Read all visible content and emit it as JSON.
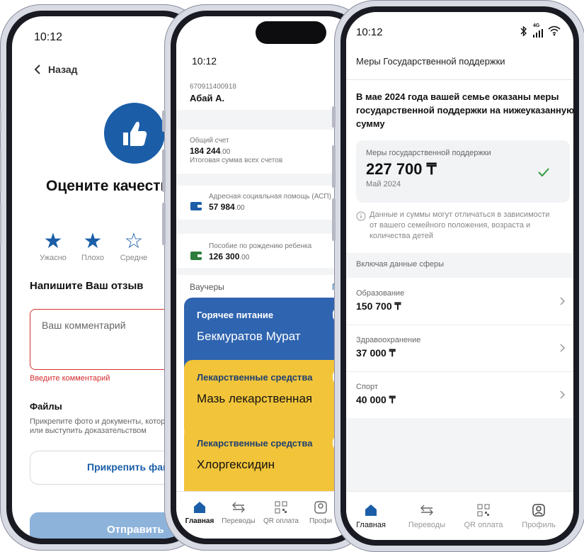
{
  "phone1": {
    "time": "10:12",
    "back_label": "Назад",
    "title": "Оцените качество",
    "ratings": [
      "Ужасно",
      "Плохо",
      "Средне"
    ],
    "ratings_selected": 2,
    "review_heading": "Напишите Ваш отзыв",
    "comment_placeholder": "Ваш комментарий",
    "comment_error": "Введите комментарий",
    "files_heading": "Файлы",
    "files_hint_line1": "Прикрепите фото и документы, котор",
    "files_hint_line2": "или выступить доказательством",
    "attach_button": "Прикрепить фай",
    "submit_button": "Отправить"
  },
  "phone2": {
    "time": "10:12",
    "account_number": "670911400918",
    "user_name": "Абай А.",
    "total": {
      "label": "Общий счет",
      "amount_main": "184 244",
      "amount_cents": ".00",
      "note": "Итоговая сумма всех счетов"
    },
    "accounts": [
      {
        "label": "Адресная социальная помощь (АСП)",
        "amount_main": "57 984",
        "amount_cents": ".00",
        "color": "#1b5ea7"
      },
      {
        "label": "Пособие по рождению ребенка",
        "amount_main": "126 300",
        "amount_cents": ".00",
        "color": "#2e7d3c"
      }
    ],
    "vouchers_heading": "Ваучеры",
    "vouchers_link": "П",
    "vouchers": [
      {
        "category": "Горячее питание",
        "name": "Бекмуратов Мурат",
        "color": "#2f64b0"
      },
      {
        "category": "Лекарственные средства",
        "name": "Мазь лекарственная",
        "color": "#f2c43a"
      },
      {
        "category": "Лекарственные средства",
        "name": "Хлоргексидин",
        "color": "#f2c43a"
      }
    ],
    "nav": [
      "Главная",
      "Переводы",
      "QR оплата",
      "Профи"
    ]
  },
  "phone3": {
    "time": "10:12",
    "network": "4G",
    "header_title": "Меры Государственной поддержки",
    "intro": [
      "В мае 2024 года вашей семье оказаны меры",
      "государственной поддержки на нижеуказанную",
      "сумму"
    ],
    "summary": {
      "label": "Меры государственной поддержки",
      "amount": "227 700 ₸",
      "period": "Май 2024"
    },
    "note": [
      "Данные и суммы могут отличаться в зависимости",
      "от вашего семейного положения, возраста и",
      "количества детей"
    ],
    "section_label": "Включая данные сферы",
    "spheres": [
      {
        "name": "Образование",
        "amount": "150 700 ₸"
      },
      {
        "name": "Здравоохранение",
        "amount": "37 000 ₸"
      },
      {
        "name": "Спорт",
        "amount": "40 000 ₸"
      }
    ],
    "nav": [
      "Главная",
      "Переводы",
      "QR оплата",
      "Профиль"
    ],
    "nav_active": 0
  },
  "colors": {
    "primary": "#1b5ea7",
    "error": "#d32f2f",
    "success": "#2e9b3a",
    "yellow": "#f2c43a"
  }
}
